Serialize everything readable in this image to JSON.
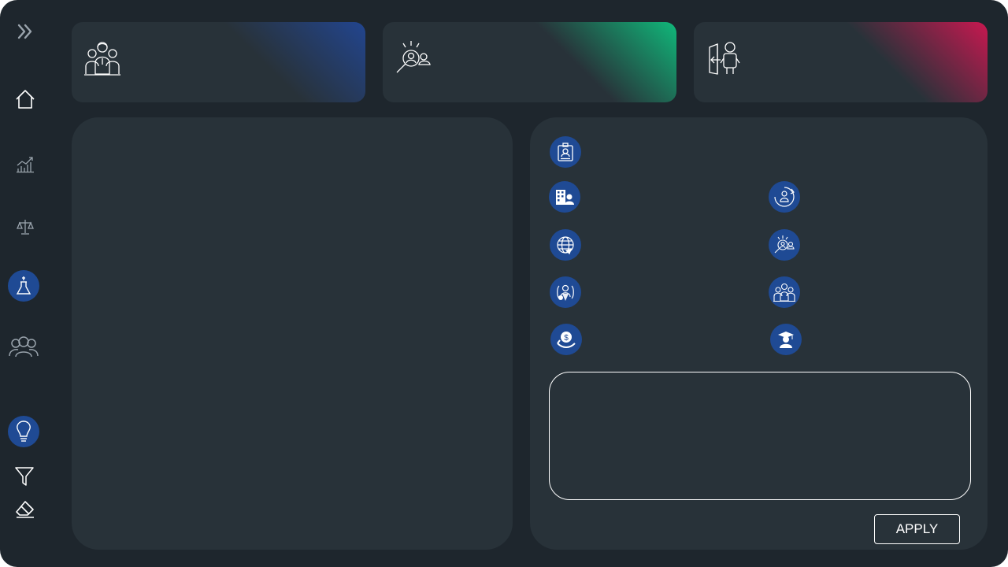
{
  "sidebar": {
    "items": [
      {
        "name": "expand",
        "icon": "double-chevron-right-icon"
      },
      {
        "name": "home",
        "icon": "home-icon"
      },
      {
        "name": "analytics",
        "icon": "line-chart-icon"
      },
      {
        "name": "balance",
        "icon": "scales-icon"
      },
      {
        "name": "lab",
        "icon": "flask-icon",
        "active": true
      },
      {
        "name": "people",
        "icon": "people-group-icon"
      },
      {
        "name": "insights",
        "icon": "lightbulb-icon",
        "active": true
      },
      {
        "name": "filter",
        "icon": "filter-icon"
      },
      {
        "name": "clear",
        "icon": "eraser-icon"
      }
    ]
  },
  "kpi_cards": [
    {
      "icon": "team-icon",
      "accent": "#22458f"
    },
    {
      "icon": "talent-search-icon",
      "accent": "#10b87a"
    },
    {
      "icon": "employee-exit-icon",
      "accent": "#c81850"
    }
  ],
  "options": [
    {
      "icon": "id-badge-icon"
    },
    {
      "icon": "office-employee-icon"
    },
    {
      "icon": "employee-cycle-icon"
    },
    {
      "icon": "global-network-icon"
    },
    {
      "icon": "talent-search-icon"
    },
    {
      "icon": "employee-care-icon"
    },
    {
      "icon": "team-icon"
    },
    {
      "icon": "salary-hand-icon"
    },
    {
      "icon": "graduate-icon"
    }
  ],
  "form": {
    "apply_label": "APPLY"
  },
  "colors": {
    "background": "#1e262d",
    "panel": "#283239",
    "icon_circle": "#1f4a94",
    "text": "#ffffff"
  }
}
